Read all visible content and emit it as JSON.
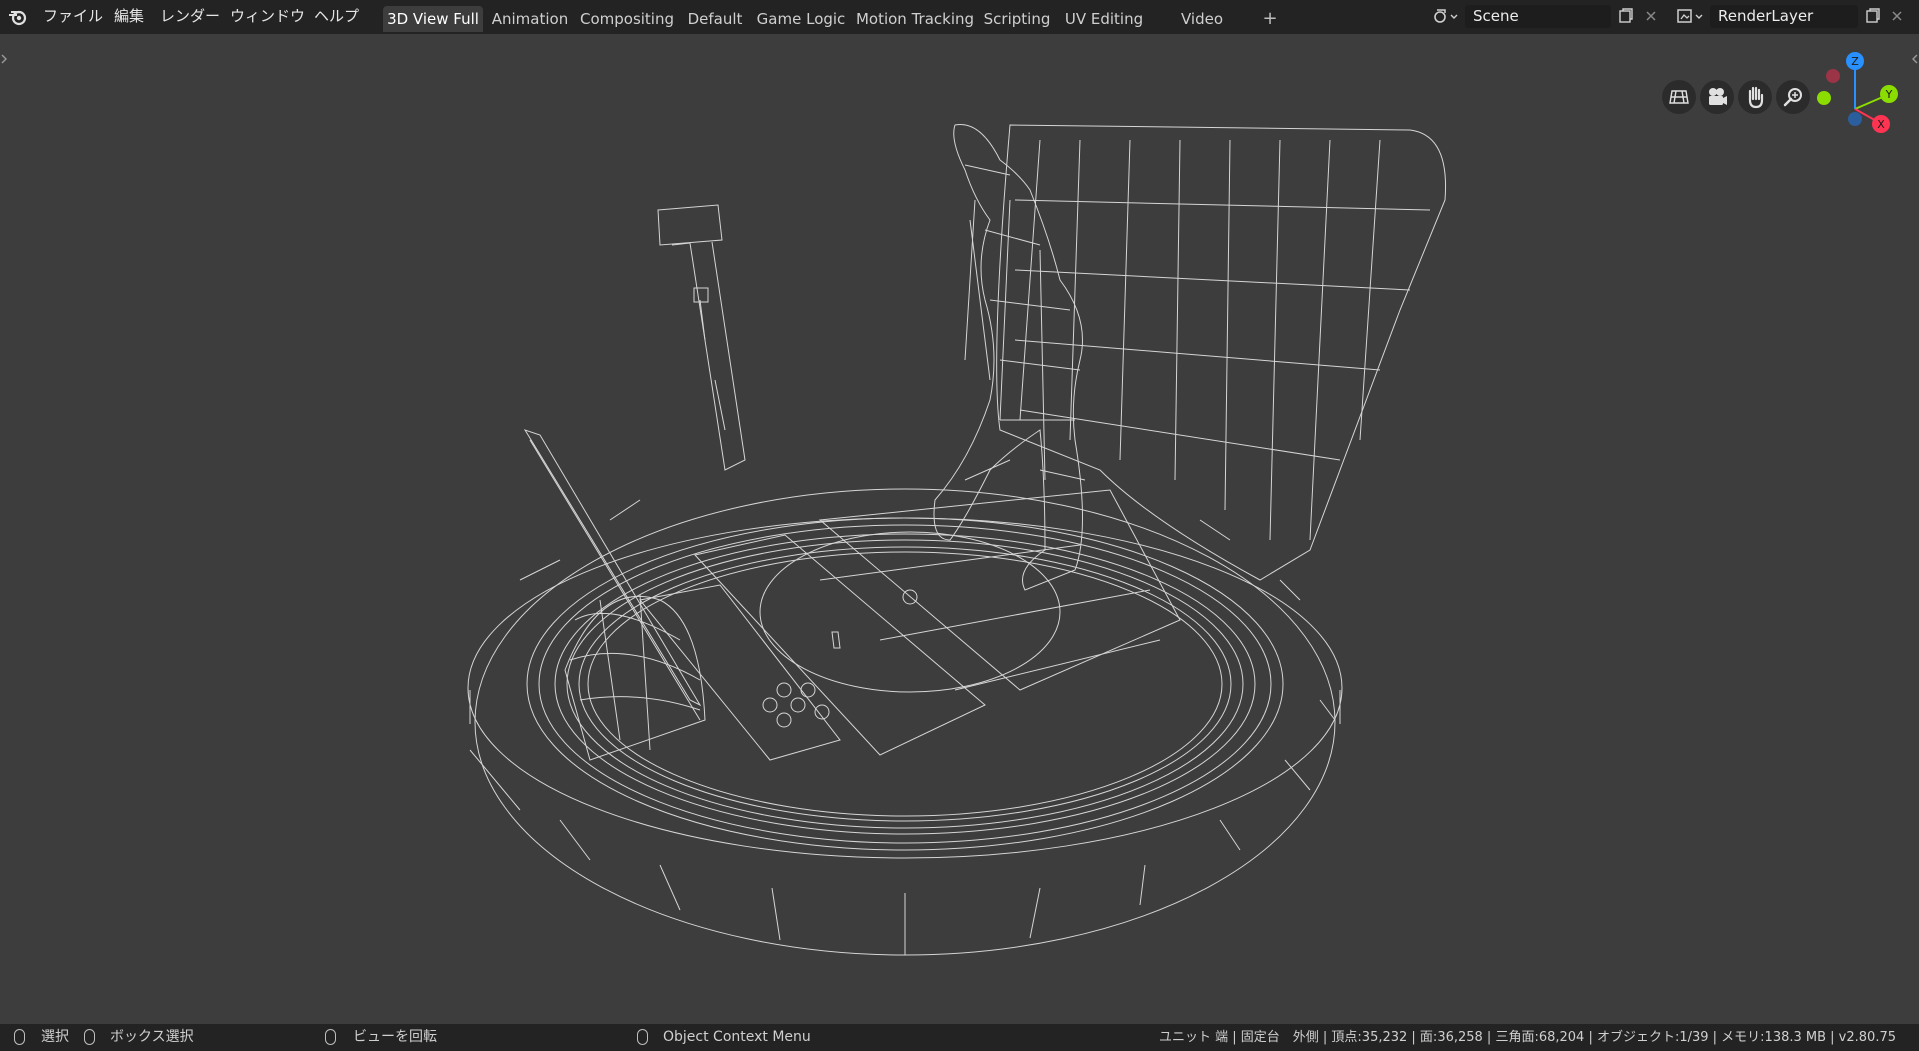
{
  "topbar": {
    "menus": [
      "ファイル",
      "編集",
      "レンダー",
      "ウィンドウ",
      "ヘルプ"
    ],
    "workspace_tabs": [
      "3D View Full",
      "Animation",
      "Compositing",
      "Default",
      "Game Logic",
      "Motion Tracking",
      "Scripting",
      "UV Editing",
      "Video Editing"
    ],
    "active_tab": "3D View Full",
    "add_tab_label": "+",
    "scene_name": "Scene",
    "render_layer": "RenderLayer"
  },
  "viewport": {
    "shading": "wireframe",
    "gizmo": {
      "z": "Z",
      "y": "Y",
      "x": "X"
    },
    "nav_icons": [
      "perspective-grid-icon",
      "camera-icon",
      "hand-pan-icon",
      "zoom-icon"
    ]
  },
  "statusbar": {
    "select_label": "選択",
    "box_select_label": "ボックス選択",
    "rotate_label": "ビューを回転",
    "context_menu_label": "Object Context Menu",
    "stats": "ユニット 端 | 固定台　外側 | 頂点:35,232 | 面:36,258 | 三角面:68,204 | オブジェクト:1/39 | メモリ:138.3 MB | v2.80.75"
  },
  "colors": {
    "header_bg": "#232323",
    "viewport_bg": "#3d3d3d",
    "wire": "#e8e8e8",
    "axis_x": "#ff3352",
    "axis_y": "#8bdc00",
    "axis_z": "#2890ff"
  }
}
